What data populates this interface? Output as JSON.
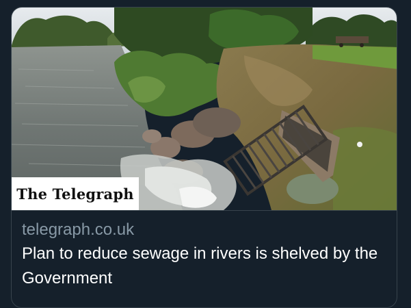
{
  "link_card": {
    "image_alt": "River with stones and a drainage grate at the bank",
    "publisher_logo": "The Telegraph",
    "domain": "telegraph.co.uk",
    "headline": "Plan to reduce sewage in rivers is shelved by the Government"
  },
  "colors": {
    "background": "#15202b",
    "border": "#38444d",
    "domain_text": "#8899a6",
    "headline_text": "#ffffff"
  }
}
